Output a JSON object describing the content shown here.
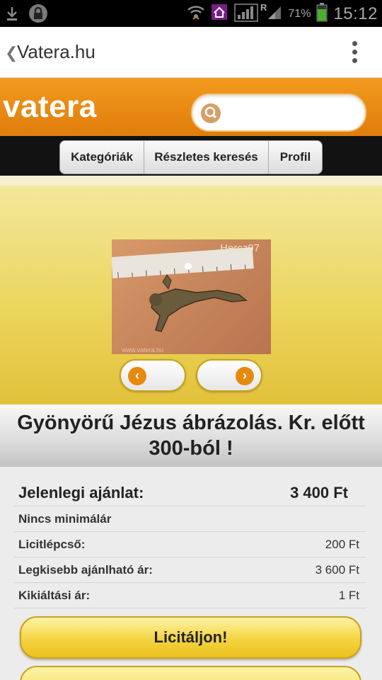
{
  "status_bar": {
    "battery": "71%",
    "network_letter": "R",
    "time": "15:12"
  },
  "browser": {
    "title": "Vatera.hu"
  },
  "header": {
    "logo": "vatera",
    "search_placeholder": ""
  },
  "nav": {
    "items": [
      {
        "label": "Kategóriák"
      },
      {
        "label": "Részletes keresés"
      },
      {
        "label": "Profil"
      }
    ]
  },
  "gallery": {
    "watermark": "Hercz07",
    "photo_url": "www.vatera.hu",
    "prev_glyph": "‹",
    "next_glyph": "›"
  },
  "product": {
    "title": "Gyönyörű Jézus ábrázolás. Kr. előtt 300-ból !"
  },
  "info": {
    "current_bid_label": "Jelenlegi ajánlat:",
    "current_bid_value": "3 400 Ft",
    "no_min_price": "Nincs minimálár",
    "bid_step_label": "Licitlépcső:",
    "bid_step_value": "200 Ft",
    "min_offer_label": "Legkisebb ajánlható ár:",
    "min_offer_value": "3 600 Ft",
    "start_price_label": "Kikiáltási ár:",
    "start_price_value": "1 Ft"
  },
  "actions": {
    "bid_label": "Licitáljon!"
  },
  "colors": {
    "brand_orange": "#e8880f",
    "accent_yellow": "#f4d340",
    "nav_dark": "#121212"
  }
}
